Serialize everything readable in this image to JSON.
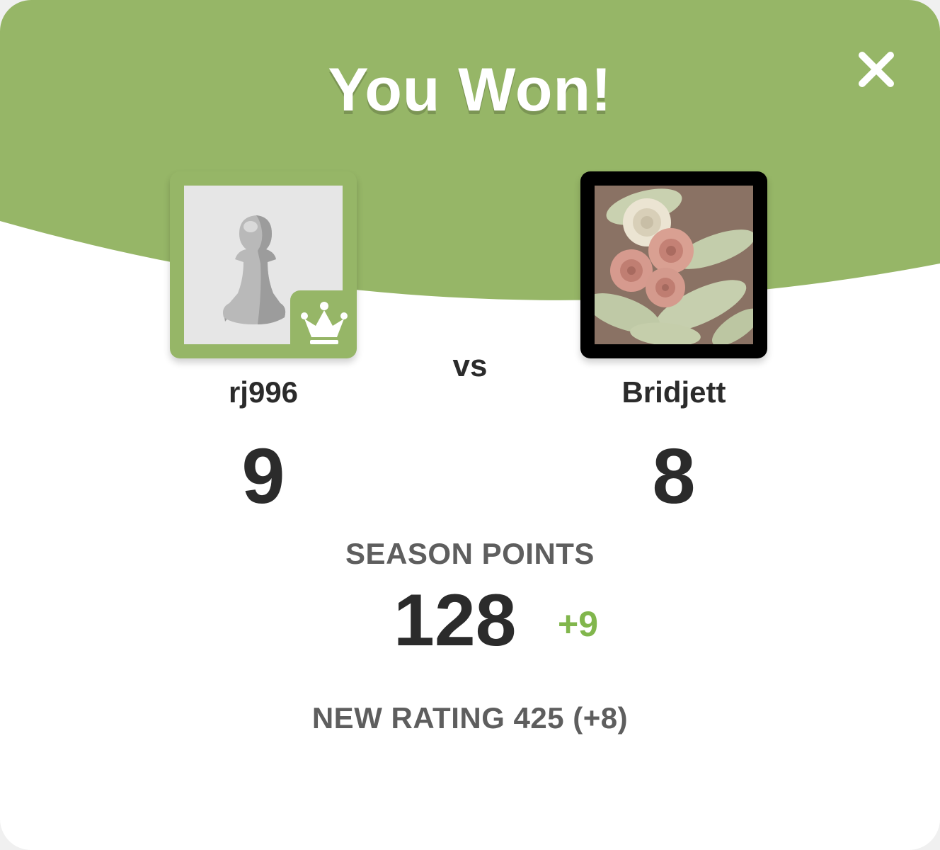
{
  "modal": {
    "title": "You Won!",
    "close_icon": "close-icon",
    "header_color": "#96b667",
    "accent_color": "#81b64c"
  },
  "players": {
    "me": {
      "name": "rj996",
      "score": "9",
      "avatar": "pawn-icon",
      "badge": "crown-icon"
    },
    "opponent": {
      "name": "Bridjett",
      "score": "8",
      "avatar": "roses-photo"
    },
    "vs_label": "vs"
  },
  "season": {
    "label": "SEASON POINTS",
    "value": "128",
    "delta": "+9"
  },
  "rating": {
    "text": "NEW RATING 425 (+8)"
  }
}
